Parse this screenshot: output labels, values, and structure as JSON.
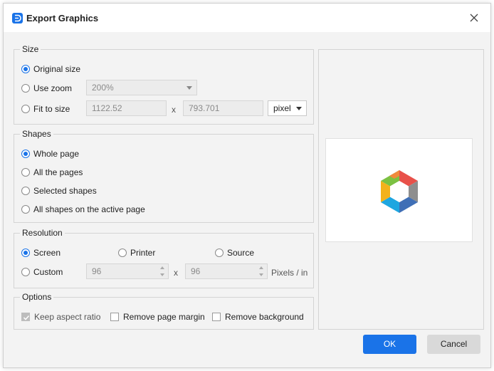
{
  "dialog": {
    "title": "Export Graphics"
  },
  "size": {
    "legend": "Size",
    "original_label": "Original size",
    "zoom_label": "Use zoom",
    "zoom_value": "200%",
    "fit_label": "Fit to size",
    "width_value": "1122.52",
    "x_sep": "x",
    "height_value": "793.701",
    "unit_value": "pixel"
  },
  "shapes": {
    "legend": "Shapes",
    "whole_page": "Whole page",
    "all_pages": "All the pages",
    "selected": "Selected shapes",
    "active_page": "All shapes on the active page"
  },
  "resolution": {
    "legend": "Resolution",
    "screen": "Screen",
    "printer": "Printer",
    "source": "Source",
    "custom": "Custom",
    "x_value": "96",
    "x_sep": "x",
    "y_value": "96",
    "unit": "Pixels / in"
  },
  "options": {
    "legend": "Options",
    "keep_aspect": "Keep aspect ratio",
    "remove_margin": "Remove page margin",
    "remove_background": "Remove background"
  },
  "buttons": {
    "ok": "OK",
    "cancel": "Cancel"
  },
  "colors": {
    "accent": "#1a73e8"
  }
}
